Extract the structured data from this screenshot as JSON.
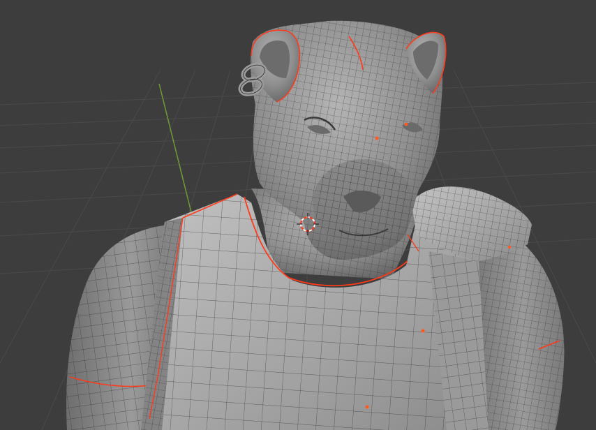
{
  "viewport": {
    "background_color": "#3d3d3d",
    "grid_color": "#4a4a4a",
    "y_axis_color": "#6f9a3a",
    "mesh_fill_color": "#8e8e8e",
    "mesh_shadow_color": "#5c5c5c",
    "wire_color": "#2b2b2b",
    "seam_color": "#ff3a1a",
    "vertex_color": "#ff5a1f",
    "cursor_icon": "3d-cursor-icon"
  }
}
